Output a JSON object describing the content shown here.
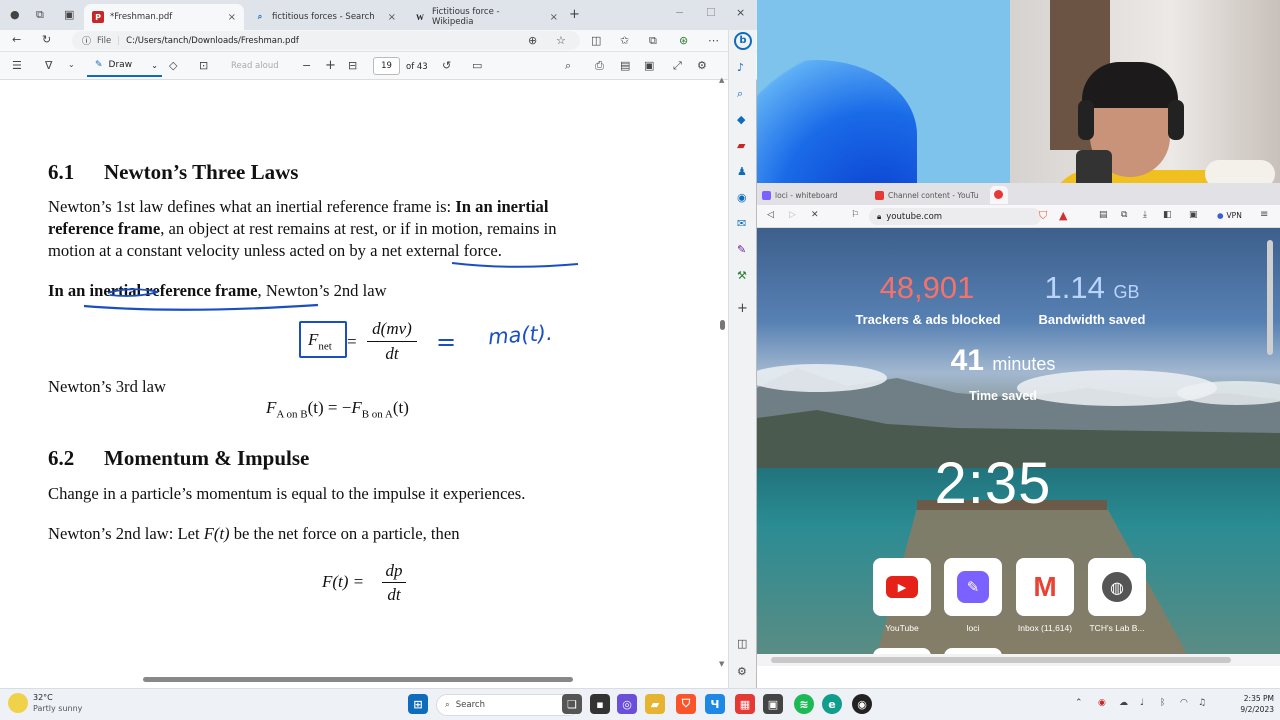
{
  "edge": {
    "tabs": [
      {
        "label": "*Freshman.pdf",
        "icon": "pdf-icon"
      },
      {
        "label": "fictitious forces - Search",
        "icon": "search-icon"
      },
      {
        "label": "Fictitious force - Wikipedia",
        "icon": "wikipedia-icon"
      }
    ],
    "address": {
      "prefix": "File",
      "url": "C:/Users/tanch/Downloads/Freshman.pdf"
    },
    "pdf_toolbar": {
      "draw": "Draw",
      "read_aloud": "Read aloud",
      "page": "19",
      "of": "of 43"
    },
    "doc": {
      "s61_num": "6.1",
      "s61_title": "Newton’s Three Laws",
      "p1_l1a": "Newton’s 1st law defines what an inertial reference frame is:",
      "p1_l1b": "In an inertial",
      "p1_l2a": "reference frame",
      "p1_l2b": ", an object at rest remains at rest, or if in motion, remains in",
      "p1_l3": "motion at a constant velocity unless acted on by a net external force.",
      "p2a": "In an inertial reference frame",
      "p2b": ", Newton’s 2nd law",
      "eq1_lhs": "F",
      "eq1_sub": "net",
      "eq1_num": "d(mv)",
      "eq1_den": "dt",
      "hand_eq": "=",
      "hand_ma": "ma(t).",
      "p3": "Newton’s 3rd law",
      "eq2": "F",
      "eq2_sub1": "A on B",
      "eq2_mid": "(t) = −",
      "eq2_sub2": "B on A",
      "eq2_end": "(t)",
      "s62_num": "6.2",
      "s62_title": "Momentum & Impulse",
      "p4": "Change in a particle’s momentum is equal to the impulse it experiences.",
      "p5a": "Newton’s 2nd law: Let",
      "p5b": "F(t)",
      "p5c": "be the net force on a particle, then",
      "eq3_lhs": "F(t) =",
      "eq3_num": "dp",
      "eq3_den": "dt"
    }
  },
  "brave": {
    "tabs": [
      {
        "label": "loci - whiteboard"
      },
      {
        "label": "Channel content - YouTu"
      }
    ],
    "url": "youtube.com",
    "vpn": "VPN",
    "stats": {
      "trackers": "48,901",
      "trackers_label": "Trackers & ads blocked",
      "bandwidth": "1.14",
      "bandwidth_unit": "GB",
      "bandwidth_label": "Bandwidth saved",
      "minutes": "41",
      "minutes_unit": "minutes",
      "time_label": "Time saved"
    },
    "clock": "2:35",
    "tiles": [
      {
        "label": "YouTube"
      },
      {
        "label": "loci"
      },
      {
        "label": "Inbox (11,614)"
      },
      {
        "label": "TCH's Lab B..."
      }
    ]
  },
  "taskbar": {
    "temp": "32°C",
    "weather": "Partly sunny",
    "search": "Search",
    "time": "2:35 PM",
    "date": "9/2/2023"
  },
  "colors": {
    "accent": "#0f6cbd",
    "ink": "#1a4fc4",
    "tracker_red": "#f4726a"
  }
}
